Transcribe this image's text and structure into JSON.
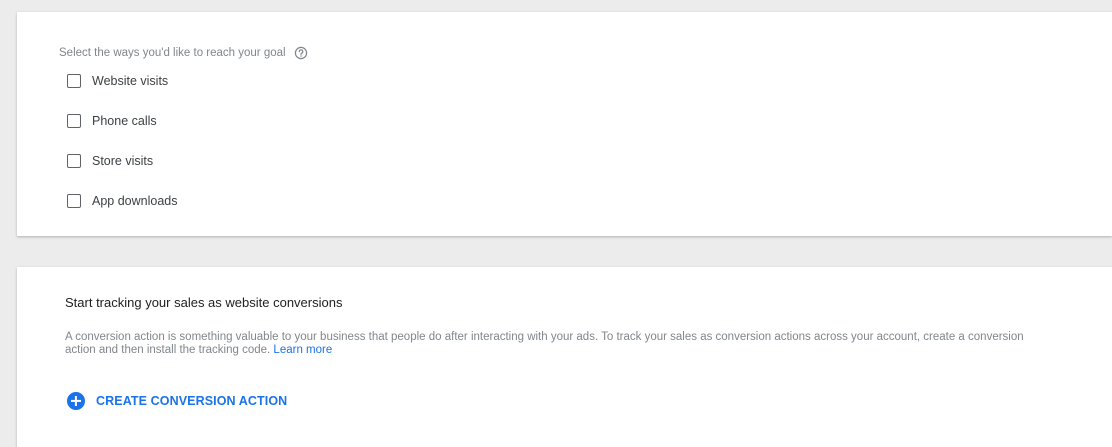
{
  "goal_section": {
    "header": "Select the ways you'd like to reach your goal",
    "help_icon": "help-circle-icon",
    "options": [
      {
        "label": "Website visits",
        "checked": false
      },
      {
        "label": "Phone calls",
        "checked": false
      },
      {
        "label": "Store visits",
        "checked": false
      },
      {
        "label": "App downloads",
        "checked": false
      }
    ]
  },
  "tracking_section": {
    "title": "Start tracking your sales as website conversions",
    "description": "A conversion action is something valuable to your business that people do after interacting with your ads. To track your sales as conversion actions across your account, create a conversion action and then install the tracking code.",
    "learn_more": "Learn more",
    "create_button": "CREATE CONVERSION ACTION",
    "create_icon": "add-circle-icon"
  },
  "colors": {
    "accent": "#1a73e8",
    "background": "#ececec",
    "card": "#ffffff",
    "muted_text": "#80868b"
  }
}
